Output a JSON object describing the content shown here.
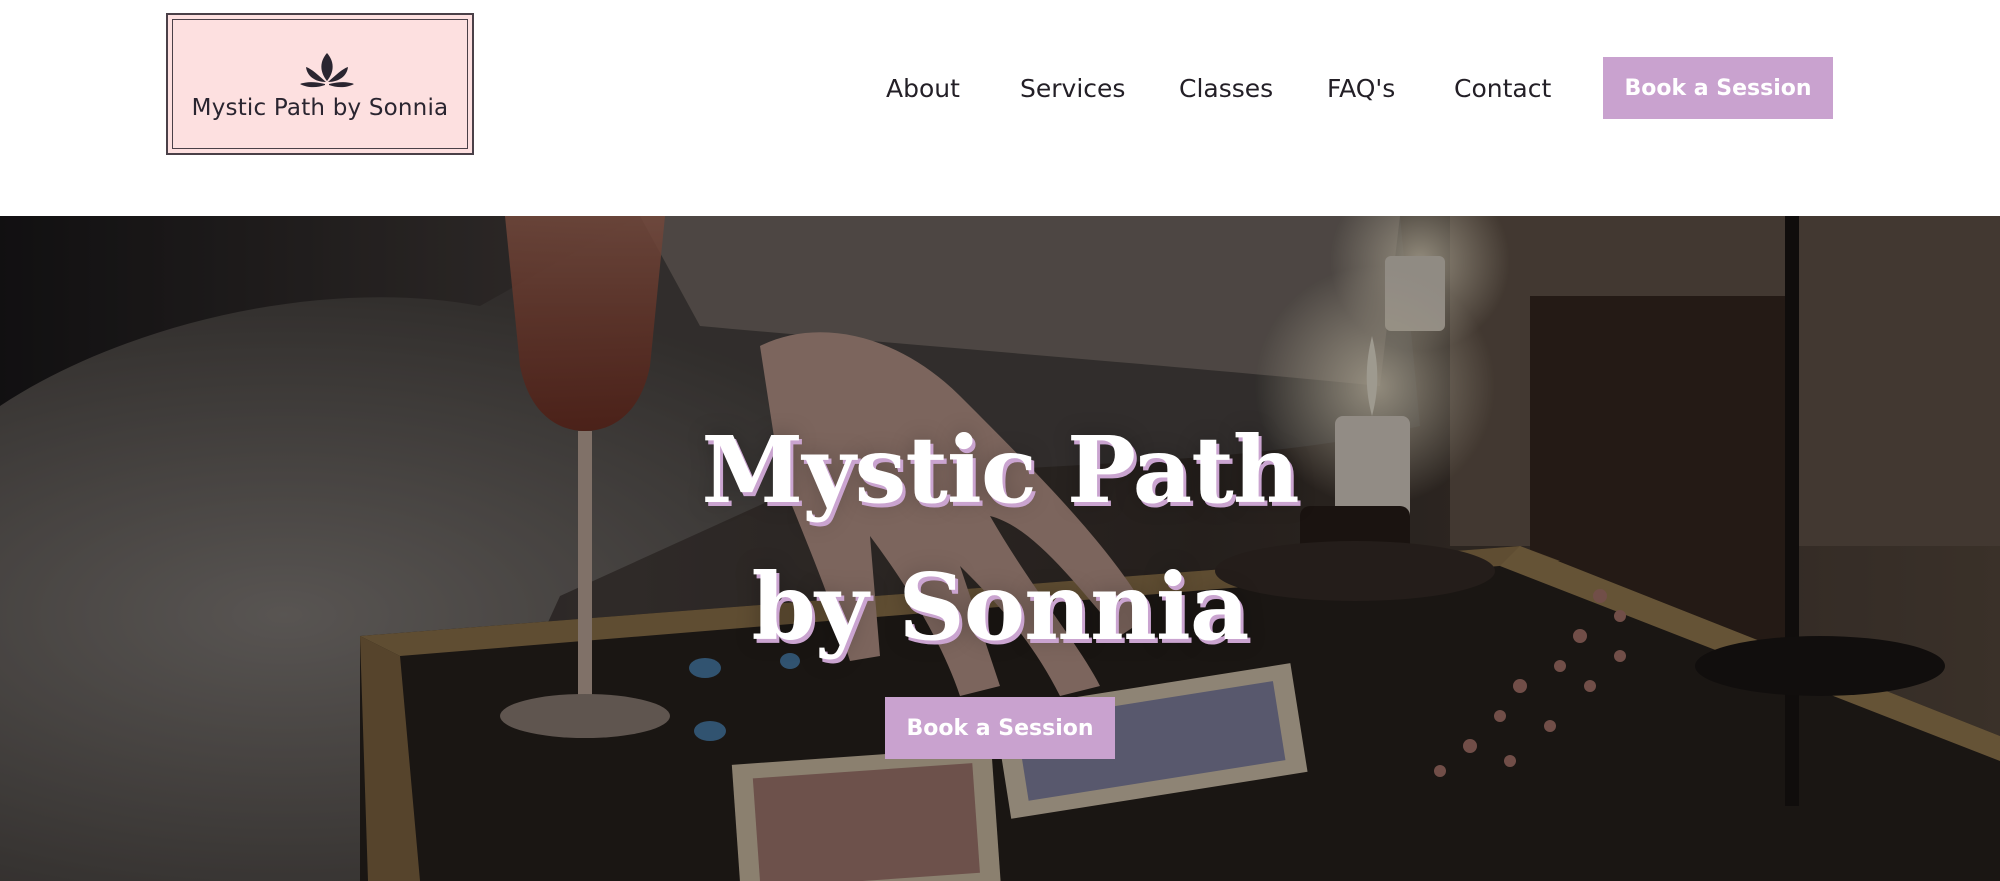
{
  "brand": {
    "name": "Mystic Path by Sonnia",
    "icon": "lotus-icon",
    "logo_background": "#fde0e0",
    "logo_border": "#4a4048"
  },
  "nav": {
    "items": [
      {
        "label": "About"
      },
      {
        "label": "Services"
      },
      {
        "label": "Classes"
      },
      {
        "label": "FAQ's"
      },
      {
        "label": "Contact"
      }
    ],
    "cta_label": "Book a Session"
  },
  "hero": {
    "title_line1": "Mystic Path",
    "title_line2": "by Sonnia",
    "cta_label": "Book a Session",
    "background_description_icon": "tarot-reading-photo"
  },
  "colors": {
    "accent": "#c9a2cf",
    "text_dark": "#231f26",
    "button_text": "#ffffff"
  }
}
